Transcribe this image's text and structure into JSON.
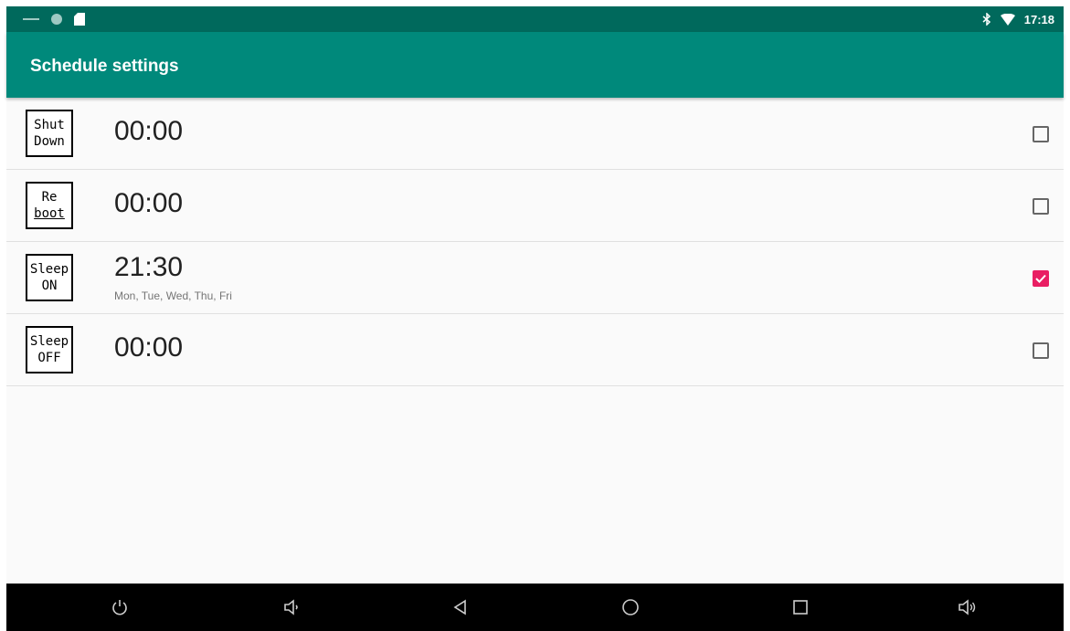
{
  "status_bar": {
    "left_icons": [
      "minus-icon",
      "circle-icon",
      "sd-card-icon"
    ],
    "right_icons": [
      "bluetooth-icon",
      "wifi-icon"
    ],
    "time": "17:18"
  },
  "app_bar": {
    "title": "Schedule settings"
  },
  "schedules": [
    {
      "icon_line1": "Shut",
      "icon_line2": "Down",
      "time": "00:00",
      "days": "",
      "checked": false
    },
    {
      "icon_line1": "Re",
      "icon_line2": "boot",
      "time": "00:00",
      "days": "",
      "checked": false
    },
    {
      "icon_line1": "Sleep",
      "icon_line2": "ON",
      "time": "21:30",
      "days": "Mon, Tue, Wed, Thu, Fri",
      "checked": true
    },
    {
      "icon_line1": "Sleep",
      "icon_line2": "OFF",
      "time": "00:00",
      "days": "",
      "checked": false
    }
  ],
  "nav_bar": {
    "buttons": [
      "power-icon",
      "volume-down-icon",
      "back-icon",
      "home-icon",
      "recents-icon",
      "volume-up-icon"
    ]
  },
  "colors": {
    "status_bar": "#00695c",
    "app_bar": "#00897b",
    "checkbox_checked": "#e91e63"
  }
}
